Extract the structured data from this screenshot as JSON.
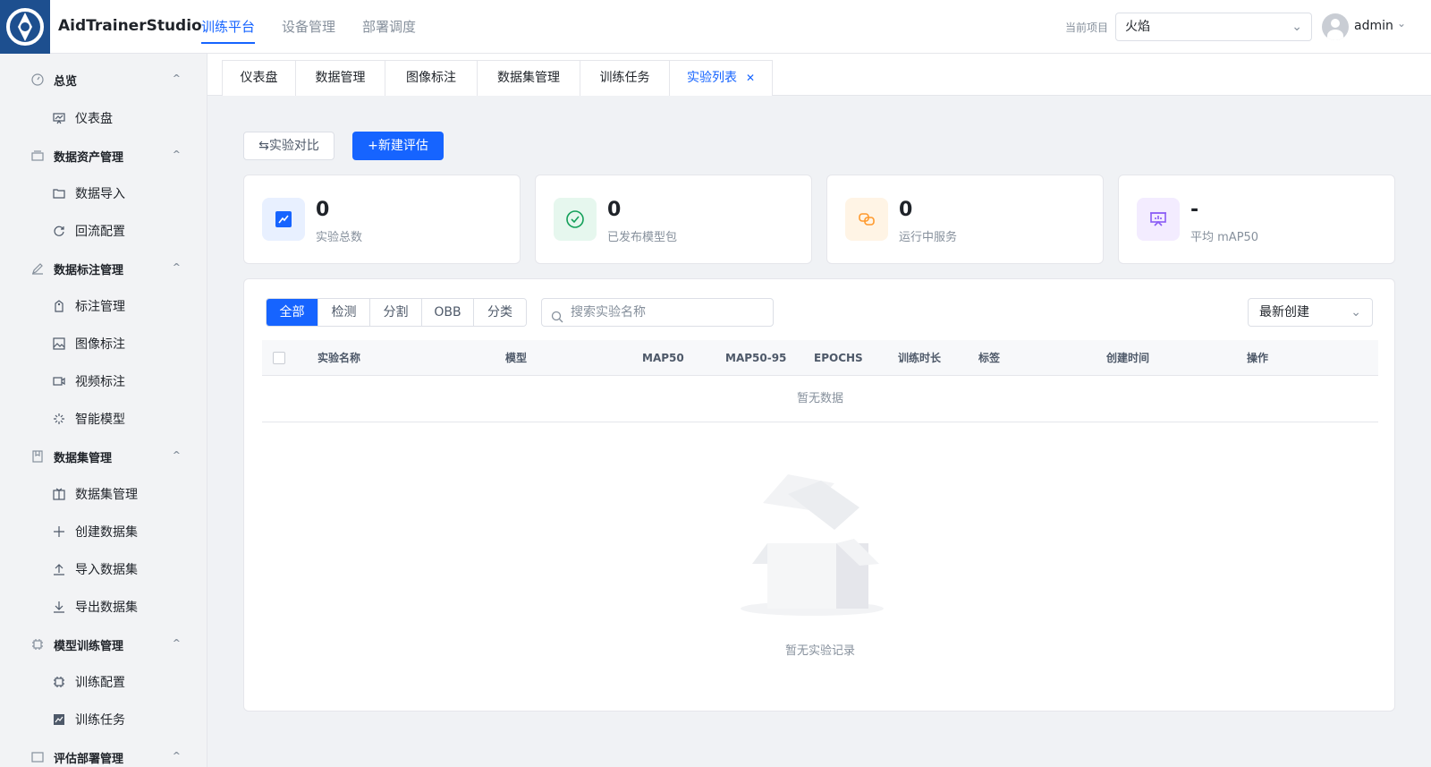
{
  "header": {
    "app_name": "AidTrainerStudio",
    "nav": [
      "训练平台",
      "设备管理",
      "部署调度"
    ],
    "project_label": "当前项目",
    "project_value": "火焰",
    "user": "admin"
  },
  "sidebar": {
    "groups": [
      {
        "label": "总览",
        "items": [
          "仪表盘"
        ]
      },
      {
        "label": "数据资产管理",
        "items": [
          "数据导入",
          "回流配置"
        ]
      },
      {
        "label": "数据标注管理",
        "items": [
          "标注管理",
          "图像标注",
          "视频标注",
          "智能模型"
        ]
      },
      {
        "label": "数据集管理",
        "items": [
          "数据集管理",
          "创建数据集",
          "导入数据集",
          "导出数据集"
        ]
      },
      {
        "label": "模型训练管理",
        "items": [
          "训练配置",
          "训练任务"
        ]
      },
      {
        "label": "评估部署管理",
        "items": []
      }
    ]
  },
  "tabs": [
    "仪表盘",
    "数据管理",
    "图像标注",
    "数据集管理",
    "训练任务",
    "实验列表"
  ],
  "toolbar": {
    "compare": "实验对比",
    "new_eval": "新建评估"
  },
  "stats": [
    {
      "value": "0",
      "label": "实验总数"
    },
    {
      "value": "0",
      "label": "已发布模型包"
    },
    {
      "value": "0",
      "label": "运行中服务"
    },
    {
      "value": "-",
      "label": "平均 mAP50"
    }
  ],
  "filters": [
    "全部",
    "检测",
    "分割",
    "OBB",
    "分类"
  ],
  "search_placeholder": "搜索实验名称",
  "sort_value": "最新创建",
  "table": {
    "columns": [
      "实验名称",
      "模型",
      "MAP50",
      "MAP50-95",
      "EPOCHS",
      "训练时长",
      "标签",
      "创建时间",
      "操作"
    ],
    "empty_row": "暂无数据"
  },
  "empty_text": "暂无实验记录",
  "colors": {
    "accent": "#1664ff",
    "logo_bg": "#1d4f8f"
  }
}
